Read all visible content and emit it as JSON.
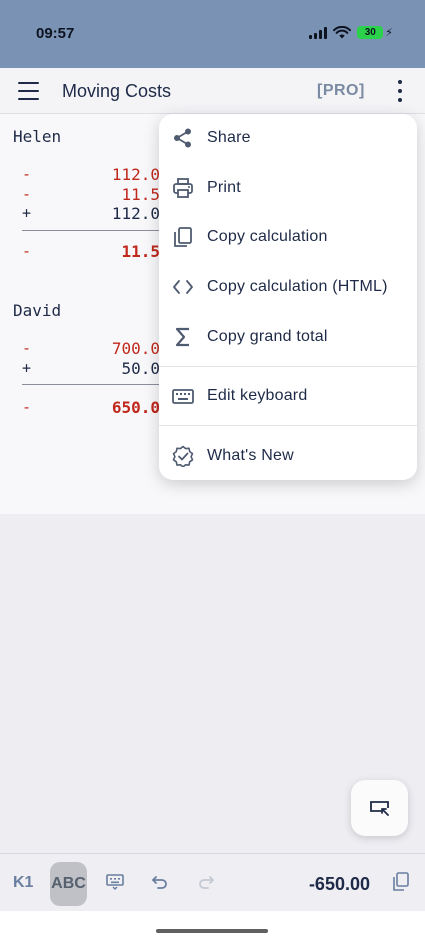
{
  "status_bar": {
    "time": "09:57",
    "battery": "30"
  },
  "app_bar": {
    "title": "Moving Costs",
    "pro_badge": "[PRO]"
  },
  "calculation": {
    "people": [
      {
        "name": "Helen",
        "lines": [
          {
            "op": "-",
            "amount": "112.0",
            "sign": "negative"
          },
          {
            "op": "-",
            "amount": "11.5",
            "sign": "negative"
          },
          {
            "op": "+",
            "amount": "112.0",
            "sign": "positive"
          }
        ],
        "total": {
          "op": "-",
          "amount": "11.5"
        }
      },
      {
        "name": "David",
        "lines": [
          {
            "op": "-",
            "amount": "700.0",
            "sign": "negative"
          },
          {
            "op": "+",
            "amount": "50.0",
            "sign": "positive"
          }
        ],
        "total": {
          "op": "-",
          "amount": "650.0"
        }
      }
    ]
  },
  "overflow_menu": {
    "items": [
      {
        "label": "Share",
        "icon": "share-icon"
      },
      {
        "label": "Print",
        "icon": "printer-icon"
      },
      {
        "label": "Copy calculation",
        "icon": "copy-icon"
      },
      {
        "label": "Copy calculation (HTML)",
        "icon": "code-icon"
      },
      {
        "label": "Copy grand total",
        "icon": "sigma-icon"
      },
      {
        "label": "Edit keyboard",
        "icon": "keyboard-icon"
      },
      {
        "label": "What's New",
        "icon": "verified-badge-icon"
      }
    ]
  },
  "bottom_bar": {
    "k1": "K1",
    "abc": "ABC",
    "grand_total": "-650.00"
  },
  "colors": {
    "status_bar_bg": "#7a93b5",
    "negative": "#c0281c",
    "positive": "#1e2a47",
    "accent": "#6a7fa0"
  }
}
